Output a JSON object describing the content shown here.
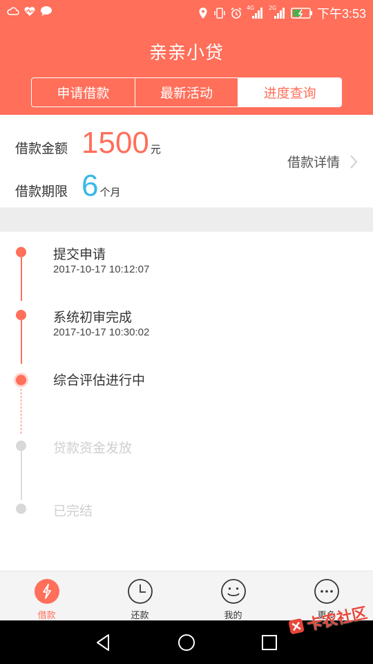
{
  "status_bar": {
    "time": "下午3:53",
    "network_labels": [
      "4G",
      "2G"
    ],
    "icons": [
      "cloud-icon",
      "heart-pulse-icon",
      "chat-icon",
      "location-icon",
      "vibrate-icon",
      "alarm-icon",
      "signal-icon",
      "signal-icon",
      "battery-charging-icon"
    ]
  },
  "header": {
    "title": "亲亲小贷",
    "tabs": [
      {
        "label": "申请借款",
        "active": false
      },
      {
        "label": "最新活动",
        "active": false
      },
      {
        "label": "进度查询",
        "active": true
      }
    ]
  },
  "summary": {
    "amount_label": "借款金额",
    "amount": "1500",
    "amount_unit": "元",
    "term_label": "借款期限",
    "term": "6",
    "term_unit": "个月",
    "details_label": "借款详情"
  },
  "timeline": [
    {
      "title": "提交申请",
      "time": "2017-10-17 10:12:07",
      "state": "done"
    },
    {
      "title": "系统初审完成",
      "time": "2017-10-17 10:30:02",
      "state": "done"
    },
    {
      "title": "综合评估进行中",
      "time": "",
      "state": "current"
    },
    {
      "title": "贷款资金发放",
      "time": "",
      "state": "pending"
    },
    {
      "title": "已完结",
      "time": "",
      "state": "pending"
    }
  ],
  "bottom_nav": [
    {
      "label": "借款",
      "icon": "lightning-icon",
      "active": true
    },
    {
      "label": "还款",
      "icon": "clock-icon",
      "active": false
    },
    {
      "label": "我的",
      "icon": "smiley-icon",
      "active": false
    },
    {
      "label": "更多",
      "icon": "more-dots-icon",
      "active": false
    }
  ],
  "watermark": "卡农社区",
  "colors": {
    "accent": "#ff6f5a",
    "term_blue": "#38b8e8",
    "pending_gray": "#d8d8d8"
  }
}
